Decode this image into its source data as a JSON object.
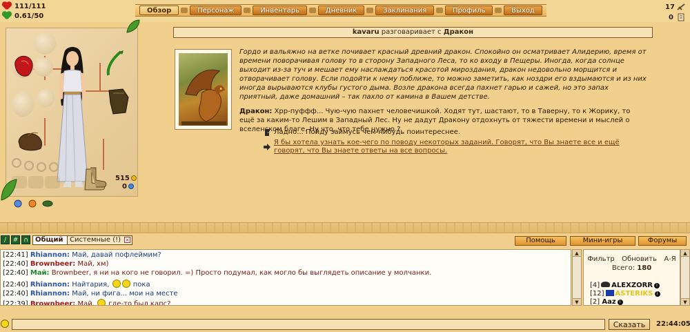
{
  "player": {
    "hp": "111/111",
    "mana": "0.61/50",
    "gold": "515",
    "gems": "0"
  },
  "nav": {
    "items": [
      "Обзор",
      "Персонаж",
      "Инвентарь",
      "Дневник",
      "Заклинания",
      "Профиль",
      "Выход"
    ],
    "active": "Обзор"
  },
  "top_right": {
    "value_1": "17",
    "value_2": "0"
  },
  "dialog": {
    "player_name": "kavaru",
    "verb": "разговаривает с",
    "npc_name": "Дракон",
    "description": "Гордо и вальяжно на ветке почивает красный древний дракон. Спокойно он осматривает Алидерию, время от времени поворачивая голову то в сторону Западного Леса, то ко входу в Пещеры. Иногда, когда солнце выходит из-за туч и мешает ему наслаждаться красотой мироздания, дракон недовольно морщится и отворачивает голову. Если подойти к нему поближе, то можно заметить, как ноздри его вздымаются и из них иногда вырываются клубы густого дыма. Возле дракона всегда пахнет гарью и сажей, но это запах приятный, даже домашний – так пахло от камина в Вашем детстве.",
    "speech_label": "Дракон:",
    "speech": "Хрр-пуффф... Чую-чую пахнет человечишкой. Ходят тут, шастают, то в Таверну, то к Жорику, то ещё за каким-то Лешим в Западный Лес. Ну не дадут Дракону отдохнуть от тяжести времени и мыслей о вселенском благе. Ну что, что тебе нужно ?",
    "options": [
      "Ладно... Пойду займусь чем-нибудь поинтереснее.",
      "Я бы хотела узнать кое-чего по поводу некоторых заданий. Говорят, что Вы знаете все и ещё говорят, что Вы знаете ответы на все вопросы."
    ]
  },
  "chat": {
    "toolbar_icons": [
      "/",
      "#",
      "∩"
    ],
    "tabs": [
      {
        "label": "Общий",
        "active": true
      },
      {
        "label": "Системные (!)",
        "active": false
      }
    ],
    "right_buttons": [
      "Помощь",
      "Мини-игры",
      "Форумы"
    ],
    "messages": [
      {
        "time": "[22:41]",
        "nick": "Rhiannon:",
        "text": "Май, давай пофлеймим?",
        "cls": "rhiannon"
      },
      {
        "time": "[22:40]",
        "nick": "Brownbeer:",
        "text": "Май, хм)",
        "cls": "brownbeer"
      },
      {
        "time": "[22:40]",
        "nick": "Май:",
        "text": "Brownbeer, я ни на кого не говорил. =) Просто подумал, как могло бы выглядеть описание у молчанки.",
        "cls": "mai"
      },
      {
        "time": "[22:40]",
        "nick": "Rhiannon:",
        "text": "Найтария,",
        "text2": "пока",
        "cls": "rhiannon",
        "smileys": 2
      },
      {
        "time": "[22:40]",
        "nick": "Rhiannon:",
        "text": "Май, ни фига... мои на месте",
        "cls": "rhiannon"
      },
      {
        "time": "[22:39]",
        "nick": "Brownbeer:",
        "text": "Май,",
        "text2": "где-то был капс?",
        "cls": "brownbeer",
        "smileys": 1
      }
    ],
    "send_label": "Сказать",
    "input_value": "",
    "clock": "22:44:05"
  },
  "userlist": {
    "filter": "Фильтр",
    "refresh": "Обновить",
    "sort": "А-Я",
    "total_label": "Всего:",
    "total": "180",
    "users": [
      {
        "level": "[4]",
        "name": "ALEXZORR",
        "badge": "guild"
      },
      {
        "level": "[12]",
        "name": "ASTERIKS",
        "badge": "flag",
        "gold": true
      },
      {
        "level": "[2]",
        "name": "Aaz",
        "badge": ""
      }
    ]
  },
  "colors": {
    "background": "#f1cf8c",
    "nav_button": "#d0841e",
    "accent_red": "#a01c1c"
  }
}
